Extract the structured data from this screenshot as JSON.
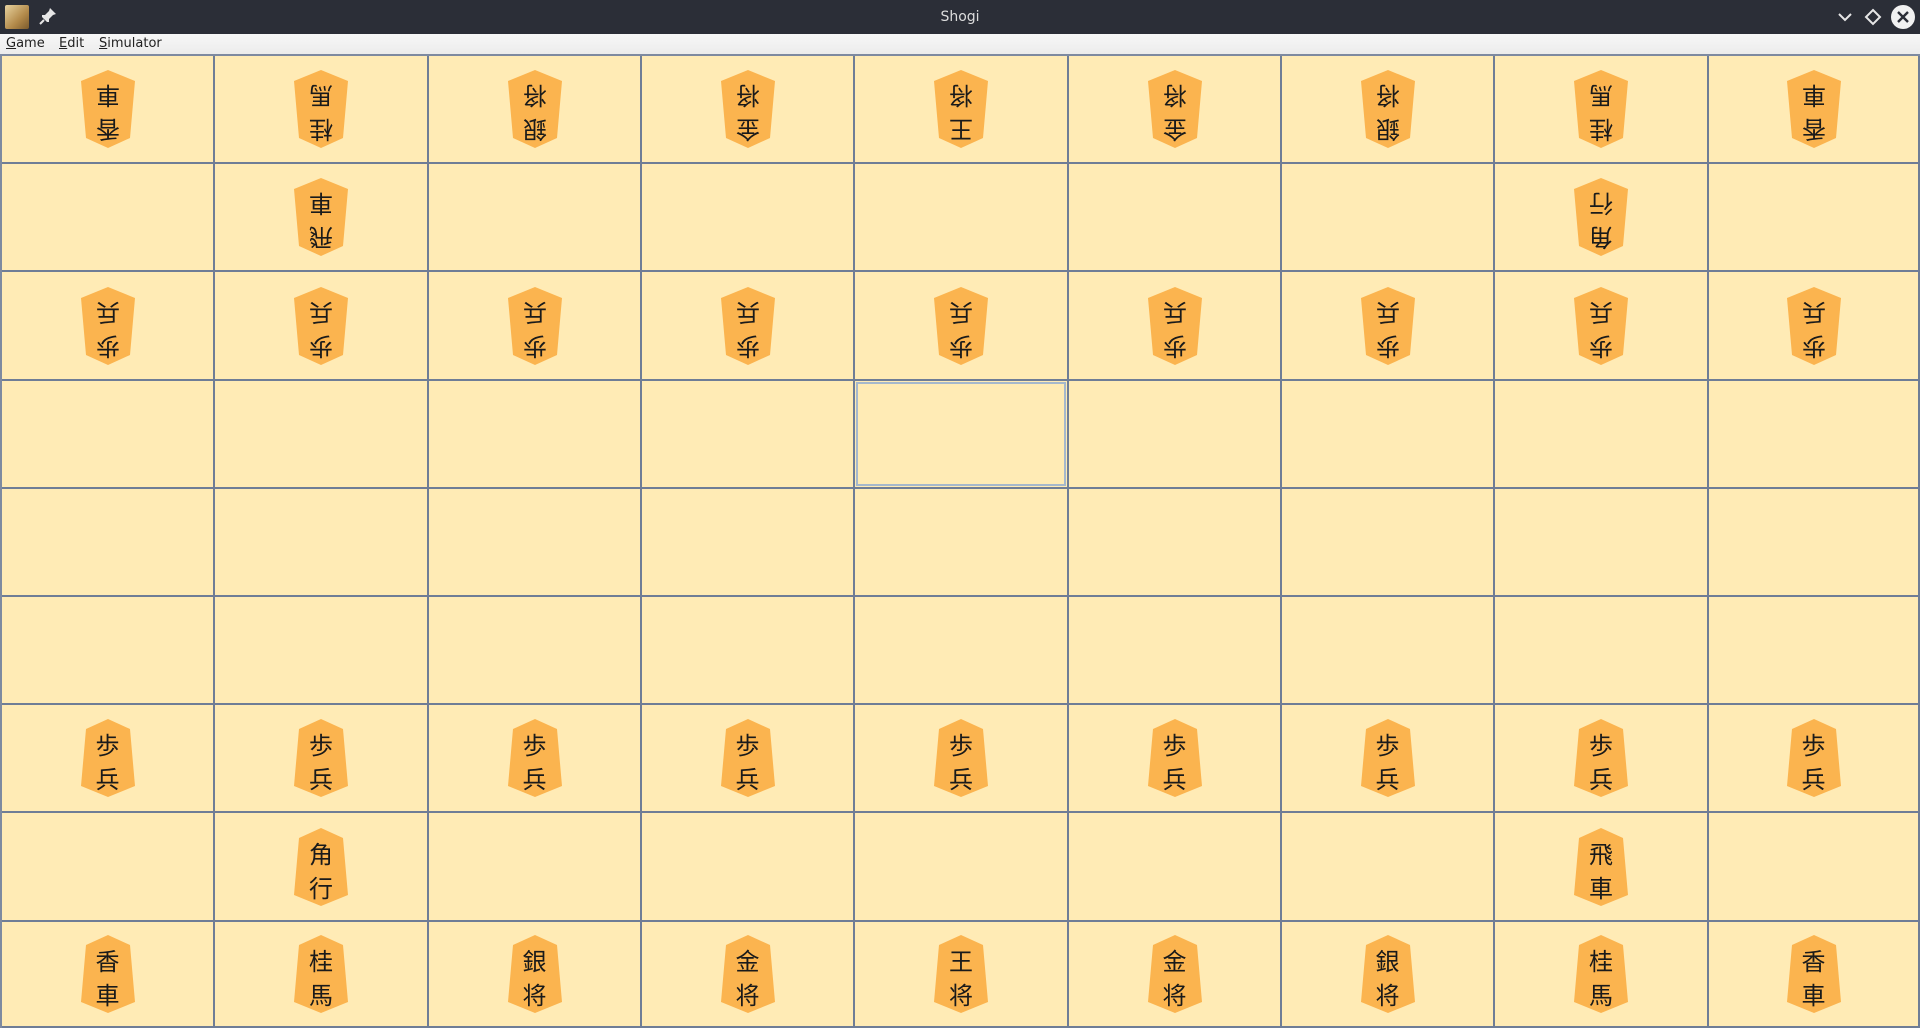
{
  "window": {
    "title": "Shogi"
  },
  "menu": [
    {
      "mnemonic": "G",
      "rest": "ame"
    },
    {
      "mnemonic": "E",
      "rest": "dit"
    },
    {
      "mnemonic": "S",
      "rest": "imulator"
    }
  ],
  "colors": {
    "cell": "#ffebb5",
    "grid": "#6f7d96",
    "piece": "#fbb44f",
    "selection": "#a6b8cc"
  },
  "selected_square": {
    "row": 4,
    "col": 5
  },
  "board": [
    [
      {
        "side": "gote",
        "chars": [
          "香",
          "車"
        ]
      },
      {
        "side": "gote",
        "chars": [
          "桂",
          "馬"
        ]
      },
      {
        "side": "gote",
        "chars": [
          "銀",
          "将"
        ]
      },
      {
        "side": "gote",
        "chars": [
          "金",
          "将"
        ]
      },
      {
        "side": "gote",
        "chars": [
          "王",
          "将"
        ]
      },
      {
        "side": "gote",
        "chars": [
          "金",
          "将"
        ]
      },
      {
        "side": "gote",
        "chars": [
          "銀",
          "将"
        ]
      },
      {
        "side": "gote",
        "chars": [
          "桂",
          "馬"
        ]
      },
      {
        "side": "gote",
        "chars": [
          "香",
          "車"
        ]
      }
    ],
    [
      null,
      {
        "side": "gote",
        "chars": [
          "飛",
          "車"
        ]
      },
      null,
      null,
      null,
      null,
      null,
      {
        "side": "gote",
        "chars": [
          "角",
          "行"
        ]
      },
      null
    ],
    [
      {
        "side": "gote",
        "chars": [
          "歩",
          "兵"
        ]
      },
      {
        "side": "gote",
        "chars": [
          "歩",
          "兵"
        ]
      },
      {
        "side": "gote",
        "chars": [
          "歩",
          "兵"
        ]
      },
      {
        "side": "gote",
        "chars": [
          "歩",
          "兵"
        ]
      },
      {
        "side": "gote",
        "chars": [
          "歩",
          "兵"
        ]
      },
      {
        "side": "gote",
        "chars": [
          "歩",
          "兵"
        ]
      },
      {
        "side": "gote",
        "chars": [
          "歩",
          "兵"
        ]
      },
      {
        "side": "gote",
        "chars": [
          "歩",
          "兵"
        ]
      },
      {
        "side": "gote",
        "chars": [
          "歩",
          "兵"
        ]
      }
    ],
    [
      null,
      null,
      null,
      null,
      null,
      null,
      null,
      null,
      null
    ],
    [
      null,
      null,
      null,
      null,
      null,
      null,
      null,
      null,
      null
    ],
    [
      null,
      null,
      null,
      null,
      null,
      null,
      null,
      null,
      null
    ],
    [
      {
        "side": "sente",
        "chars": [
          "歩",
          "兵"
        ]
      },
      {
        "side": "sente",
        "chars": [
          "歩",
          "兵"
        ]
      },
      {
        "side": "sente",
        "chars": [
          "歩",
          "兵"
        ]
      },
      {
        "side": "sente",
        "chars": [
          "歩",
          "兵"
        ]
      },
      {
        "side": "sente",
        "chars": [
          "歩",
          "兵"
        ]
      },
      {
        "side": "sente",
        "chars": [
          "歩",
          "兵"
        ]
      },
      {
        "side": "sente",
        "chars": [
          "歩",
          "兵"
        ]
      },
      {
        "side": "sente",
        "chars": [
          "歩",
          "兵"
        ]
      },
      {
        "side": "sente",
        "chars": [
          "歩",
          "兵"
        ]
      }
    ],
    [
      null,
      {
        "side": "sente",
        "chars": [
          "角",
          "行"
        ]
      },
      null,
      null,
      null,
      null,
      null,
      {
        "side": "sente",
        "chars": [
          "飛",
          "車"
        ]
      },
      null
    ],
    [
      {
        "side": "sente",
        "chars": [
          "香",
          "車"
        ]
      },
      {
        "side": "sente",
        "chars": [
          "桂",
          "馬"
        ]
      },
      {
        "side": "sente",
        "chars": [
          "銀",
          "将"
        ]
      },
      {
        "side": "sente",
        "chars": [
          "金",
          "将"
        ]
      },
      {
        "side": "sente",
        "chars": [
          "王",
          "将"
        ]
      },
      {
        "side": "sente",
        "chars": [
          "金",
          "将"
        ]
      },
      {
        "side": "sente",
        "chars": [
          "銀",
          "将"
        ]
      },
      {
        "side": "sente",
        "chars": [
          "桂",
          "馬"
        ]
      },
      {
        "side": "sente",
        "chars": [
          "香",
          "車"
        ]
      }
    ]
  ]
}
